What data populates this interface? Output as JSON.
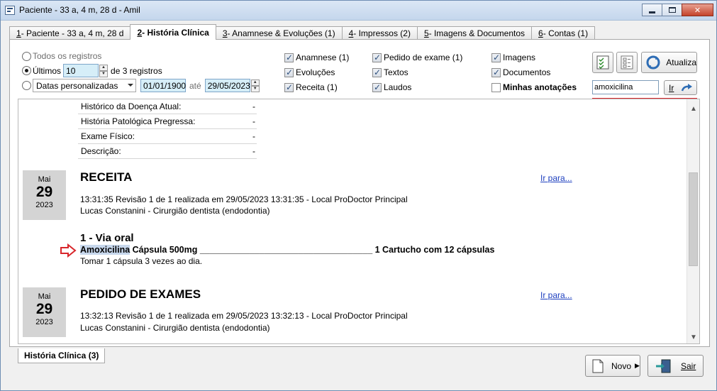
{
  "window": {
    "title": "Paciente - 33 a, 4 m, 28 d - Amil"
  },
  "tabs": [
    {
      "num": "1",
      "label": " - Paciente - 33 a, 4 m, 28 d"
    },
    {
      "num": "2",
      "label": " - História Clínica"
    },
    {
      "num": "3",
      "label": " - Anamnese & Evoluções  (1)"
    },
    {
      "num": "4",
      "label": " - Impressos  (2)"
    },
    {
      "num": "5",
      "label": " - Imagens & Documentos"
    },
    {
      "num": "6",
      "label": " - Contas  (1)"
    }
  ],
  "filters": {
    "all_label": "Todos os registros",
    "last_label": "Últimos",
    "last_value": "10",
    "last_suffix": "de 3 registros",
    "custom_label": "Datas personalizadas",
    "date_from": "01/01/1900",
    "date_sep": "até",
    "date_to": "29/05/2023"
  },
  "checks": {
    "anamnese": "Anamnese (1)",
    "evolucoes": "Evoluções",
    "receita": "Receita (1)",
    "pedido": "Pedido de exame (1)",
    "textos": "Textos",
    "laudos": "Laudos",
    "imagens": "Imagens",
    "documentos": "Documentos",
    "minhas": "Minhas anotações"
  },
  "toolbar": {
    "refresh_label": "Atualiza",
    "search_value": "amoxicilina",
    "go_label": "Ir"
  },
  "anamnese_fields": [
    {
      "label": "Histórico da Doença Atual:",
      "value": "-"
    },
    {
      "label": "História Patológica Pregressa:",
      "value": "-"
    },
    {
      "label": "Exame Físico:",
      "value": "-"
    },
    {
      "label": "Descrição:",
      "value": "-"
    }
  ],
  "receita": {
    "month": "Mai",
    "day": "29",
    "year": "2023",
    "title": "RECEITA",
    "goto": "Ir para...",
    "meta": "13:31:35  Revisão 1 de 1  realizada em 29/05/2023 13:31:35 - Local ProDoctor Principal",
    "doctor": "Lucas Constanini - Cirurgião dentista (endodontia)",
    "route": "1 - Via oral",
    "drug_highlight": "Amoxicilina",
    "drug_rest": " Cápsula 500mg ___________________________________ 1 Cartucho com 12 cápsulas",
    "instructions": "Tomar 1 cápsula 3 vezes ao dia."
  },
  "pedido": {
    "month": "Mai",
    "day": "29",
    "year": "2023",
    "title": "PEDIDO DE EXAMES",
    "goto": "Ir para...",
    "meta": "13:32:13  Revisão 1 de 1  realizada em 29/05/2023 13:32:13 - Local ProDoctor Principal",
    "doctor": "Lucas Constanini - Cirurgião dentista (endodontia)"
  },
  "bottom": {
    "tab_label": "História Clínica (3)",
    "new_label": "Novo",
    "exit_label": "Sair"
  }
}
